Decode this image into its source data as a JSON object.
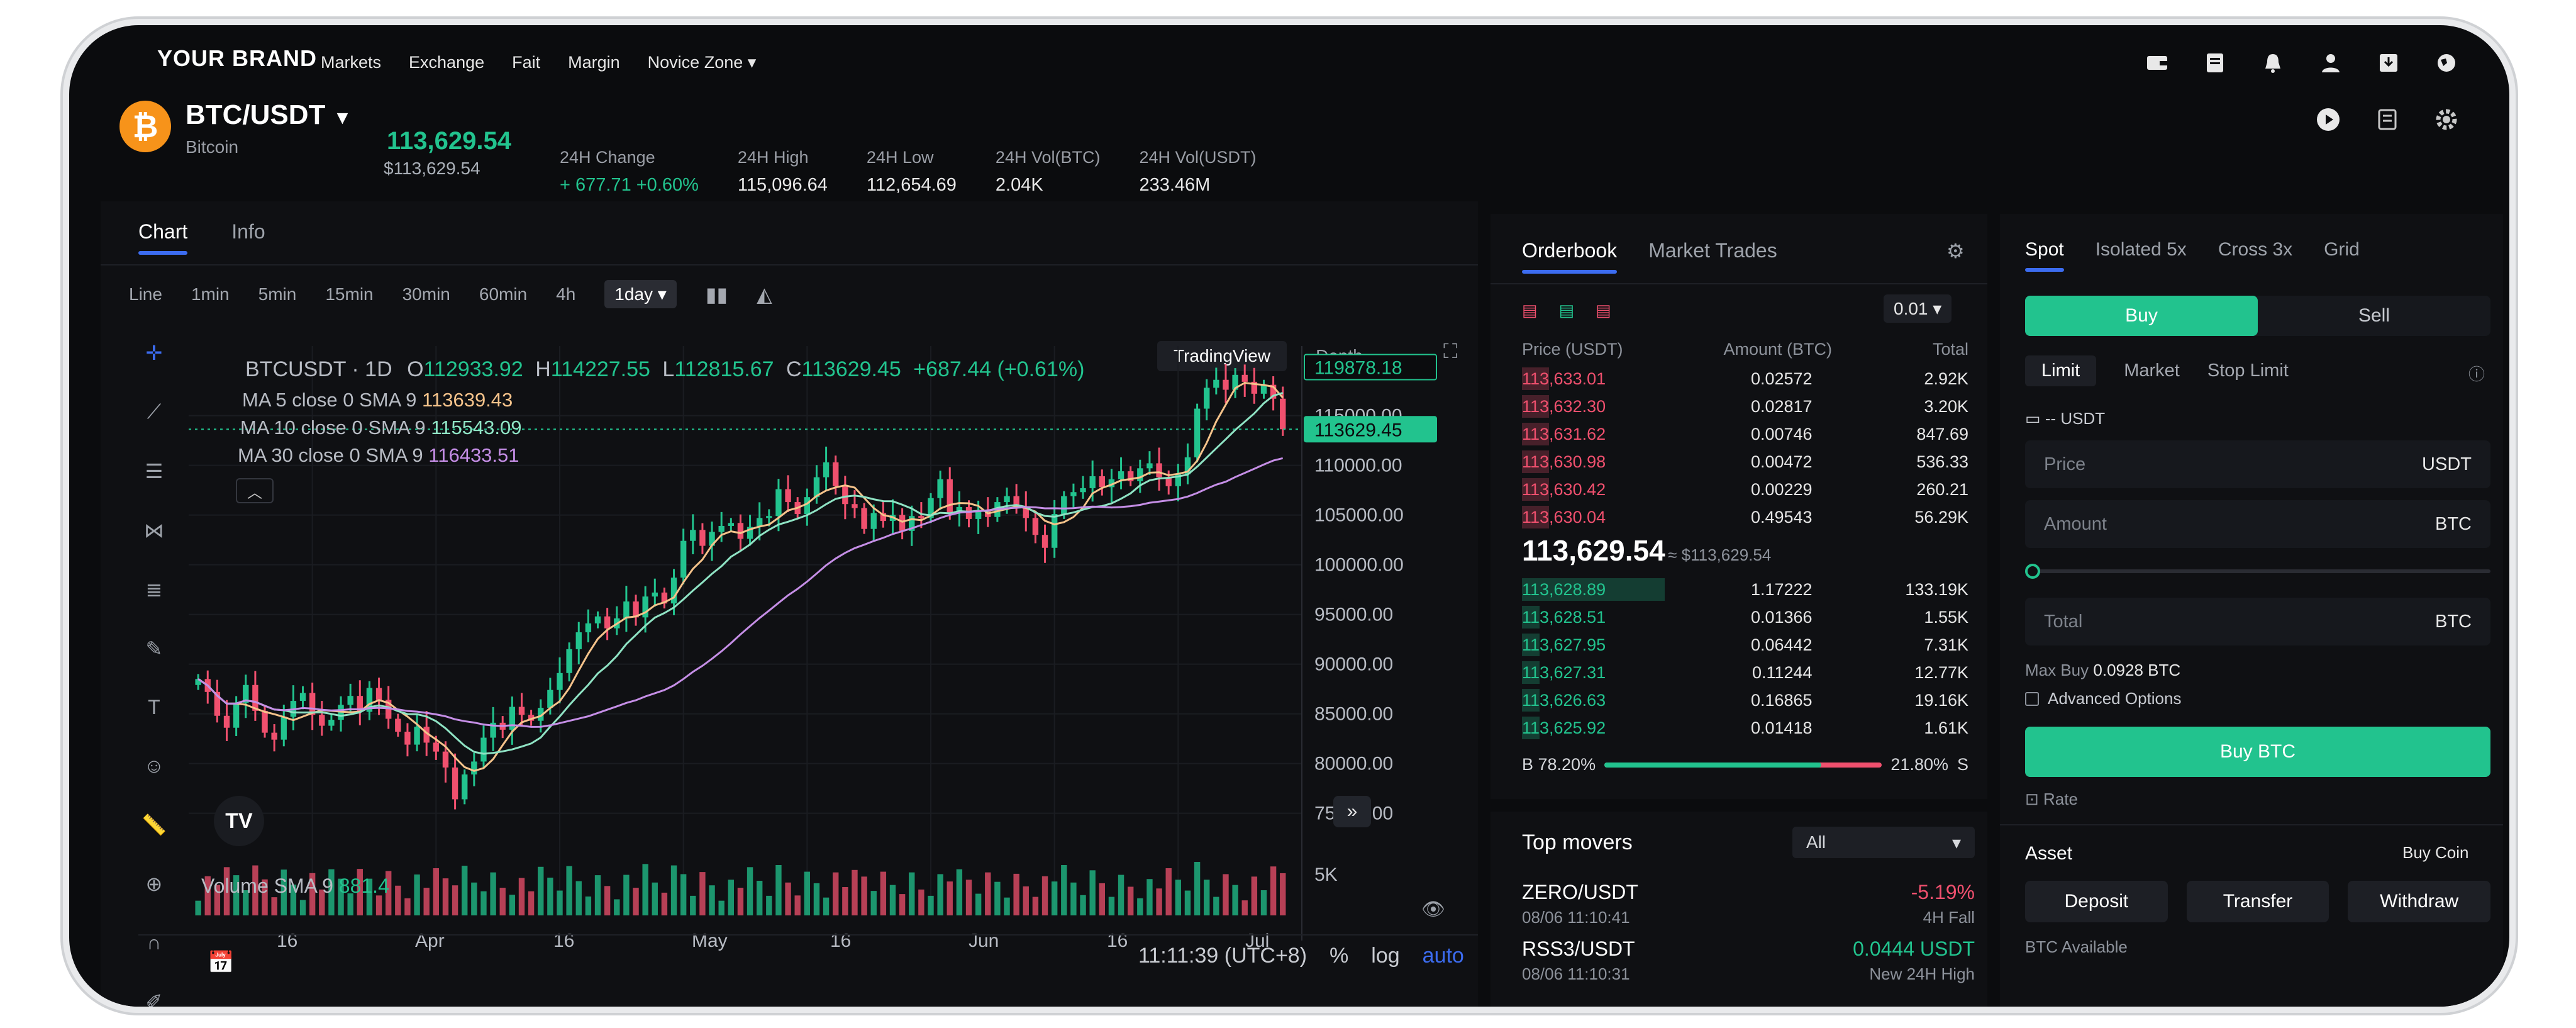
{
  "brand": "YOUR BRAND",
  "nav": [
    "Markets",
    "Exchange",
    "Fait",
    "Margin",
    "Novice Zone"
  ],
  "top_icons": [
    "wallet-icon",
    "orders-icon",
    "bell-icon",
    "user-icon",
    "download-icon",
    "globe-icon"
  ],
  "header_icons": [
    "play-icon",
    "book-icon",
    "gear-icon"
  ],
  "pair": {
    "symbol": "BTC/USDT",
    "name": "Bitcoin",
    "last": "113,629.54",
    "last_usd": "$113,629.54"
  },
  "stats": [
    {
      "label": "24H Change",
      "value": "+ 677.71 +0.60%",
      "color": "#22c38e"
    },
    {
      "label": "24H High",
      "value": "115,096.64"
    },
    {
      "label": "24H Low",
      "value": "112,654.69"
    },
    {
      "label": "24H Vol(BTC)",
      "value": "2.04K"
    },
    {
      "label": "24H Vol(USDT)",
      "value": "233.46M"
    }
  ],
  "chart_tabs": [
    "Chart",
    "Info"
  ],
  "timeframes": [
    "Line",
    "1min",
    "5min",
    "15min",
    "30min",
    "60min",
    "4h",
    "1day"
  ],
  "view_modes": [
    "TradingView",
    "Depth"
  ],
  "chart_legend": {
    "ohlc_title": "BTCUSDT · 1D",
    "o_label": "O",
    "o": "112933.92",
    "h_label": "H",
    "h": "114227.55",
    "l_label": "L",
    "l": "112815.67",
    "c_label": "C",
    "c": "113629.45",
    "chg": "+687.44 (+0.61%)",
    "ma5_label": "MA 5 close 0 SMA 9",
    "ma5": "113639.43",
    "ma10_label": "MA 10 close 0 SMA 9",
    "ma10": "115543.09",
    "ma30_label": "MA 30 close 0 SMA 9",
    "ma30": "116433.51",
    "vol_label": "Volume SMA 9",
    "vol": "881.4"
  },
  "chart_data": {
    "type": "candlestick",
    "x_ticks": [
      "16",
      "Apr",
      "16",
      "May",
      "16",
      "Jun",
      "16",
      "Jul"
    ],
    "y_ticks": [
      "105000.00",
      "100000.00",
      "95000.00",
      "90000.00",
      "85000.00",
      "80000.00",
      "75000.00"
    ],
    "y_ticks_top": [
      "115000.00",
      "110000.00"
    ],
    "ylim": [
      72000,
      122000
    ],
    "price_tags": [
      {
        "value": "119878.18",
        "price": 119878.18,
        "style": "outline"
      },
      {
        "value": "113629.45",
        "price": 113629.45,
        "style": "filled"
      }
    ],
    "volume_tick": "5K",
    "closes": [
      88500,
      87200,
      84800,
      83600,
      86100,
      87900,
      85300,
      83100,
      82400,
      84700,
      86300,
      87100,
      84900,
      83800,
      84400,
      85900,
      86800,
      85200,
      87600,
      86400,
      84500,
      83200,
      81900,
      83700,
      82100,
      81200,
      79600,
      76400,
      78900,
      80200,
      82600,
      84100,
      83400,
      85700,
      84900,
      84300,
      85600,
      87400,
      89100,
      91500,
      93200,
      94100,
      94800,
      93600,
      94600,
      96300,
      94700,
      96800,
      97200,
      96100,
      98700,
      102400,
      103500,
      101900,
      103300,
      103900,
      104200,
      102600,
      103800,
      104700,
      104900,
      107600,
      106300,
      105100,
      106800,
      108800,
      110300,
      107900,
      106100,
      105700,
      103600,
      105200,
      104400,
      105000,
      103400,
      104900,
      104700,
      106700,
      108600,
      105200,
      105800,
      104600,
      105400,
      104800,
      106300,
      106900,
      105800,
      104700,
      103000,
      101700,
      105100,
      106900,
      107300,
      107700,
      108900,
      107800,
      108600,
      109400,
      108400,
      109700,
      110200,
      108800,
      107900,
      109100,
      110800,
      115700,
      117800,
      118600,
      117600,
      119100,
      118400,
      117200,
      118100,
      116700,
      113629
    ],
    "ma_lines": [
      "MA 5",
      "MA 10",
      "MA 30"
    ]
  },
  "chart_footer": {
    "time": "11:11:39 (UTC+8)",
    "pct": "%",
    "log": "log",
    "auto": "auto"
  },
  "orderbook": {
    "tabs": [
      "Orderbook",
      "Market Trades"
    ],
    "precision": "0.01",
    "headers": [
      "Price (USDT)",
      "Amount (BTC)",
      "Total"
    ],
    "asks": [
      {
        "price": "113,633.01",
        "amount": "0.02572",
        "total": "2.92K",
        "depth": 0.06
      },
      {
        "price": "113,632.30",
        "amount": "0.02817",
        "total": "3.20K",
        "depth": 0.06
      },
      {
        "price": "113,631.62",
        "amount": "0.00746",
        "total": "847.69",
        "depth": 0.06
      },
      {
        "price": "113,630.98",
        "amount": "0.00472",
        "total": "536.33",
        "depth": 0.06
      },
      {
        "price": "113,630.42",
        "amount": "0.00229",
        "total": "260.21",
        "depth": 0.06
      },
      {
        "price": "113,630.04",
        "amount": "0.49543",
        "total": "56.29K",
        "depth": 0.06
      }
    ],
    "mid": "113,629.54",
    "mid_usd": "≈ $113,629.54",
    "bids": [
      {
        "price": "113,628.89",
        "amount": "1.17222",
        "total": "133.19K",
        "depth": 0.32
      },
      {
        "price": "113,628.51",
        "amount": "0.01366",
        "total": "1.55K",
        "depth": 0.04
      },
      {
        "price": "113,627.95",
        "amount": "0.06442",
        "total": "7.31K",
        "depth": 0.04
      },
      {
        "price": "113,627.31",
        "amount": "0.11244",
        "total": "12.77K",
        "depth": 0.04
      },
      {
        "price": "113,626.63",
        "amount": "0.16865",
        "total": "19.16K",
        "depth": 0.04
      },
      {
        "price": "113,625.92",
        "amount": "0.01418",
        "total": "1.61K",
        "depth": 0.04
      }
    ],
    "buy_ratio": "B 78.20%",
    "buy_pct": 78.2,
    "sell_ratio": "21.80%",
    "sell_label": "S"
  },
  "movers": {
    "title": "Top movers",
    "filter": "All",
    "items": [
      {
        "pair": "ZERO/USDT",
        "time": "08/06 11:10:41",
        "change": "-5.19%",
        "note": "4H Fall",
        "color": "#f0506e"
      },
      {
        "pair": "RSS3/USDT",
        "time": "08/06 11:10:31",
        "change": "0.0444 USDT",
        "note": "New 24H High",
        "color": "#22c38e"
      }
    ]
  },
  "trade": {
    "modes": [
      "Spot",
      "Isolated 5x",
      "Cross 3x",
      "Grid"
    ],
    "sides": [
      "Buy",
      "Sell"
    ],
    "order_types": [
      "Limit",
      "Market",
      "Stop Limit"
    ],
    "balance": "-- USDT",
    "price_placeholder": "Price",
    "price_unit": "USDT",
    "amount_placeholder": "Amount",
    "amount_unit": "BTC",
    "slider_pct": 0,
    "total_placeholder": "Total",
    "total_unit": "BTC",
    "max_buy_label": "Max Buy",
    "max_buy": "0.0928 BTC",
    "advanced": "Advanced Options",
    "submit": "Buy BTC",
    "rate": "Rate",
    "asset_title": "Asset",
    "buy_coin": "Buy Coin",
    "asset_buttons": [
      "Deposit",
      "Transfer",
      "Withdraw"
    ],
    "available": "BTC Available"
  },
  "colors": {
    "up": "#22c38e",
    "down": "#f0506e",
    "accent": "#3c6cf0"
  }
}
